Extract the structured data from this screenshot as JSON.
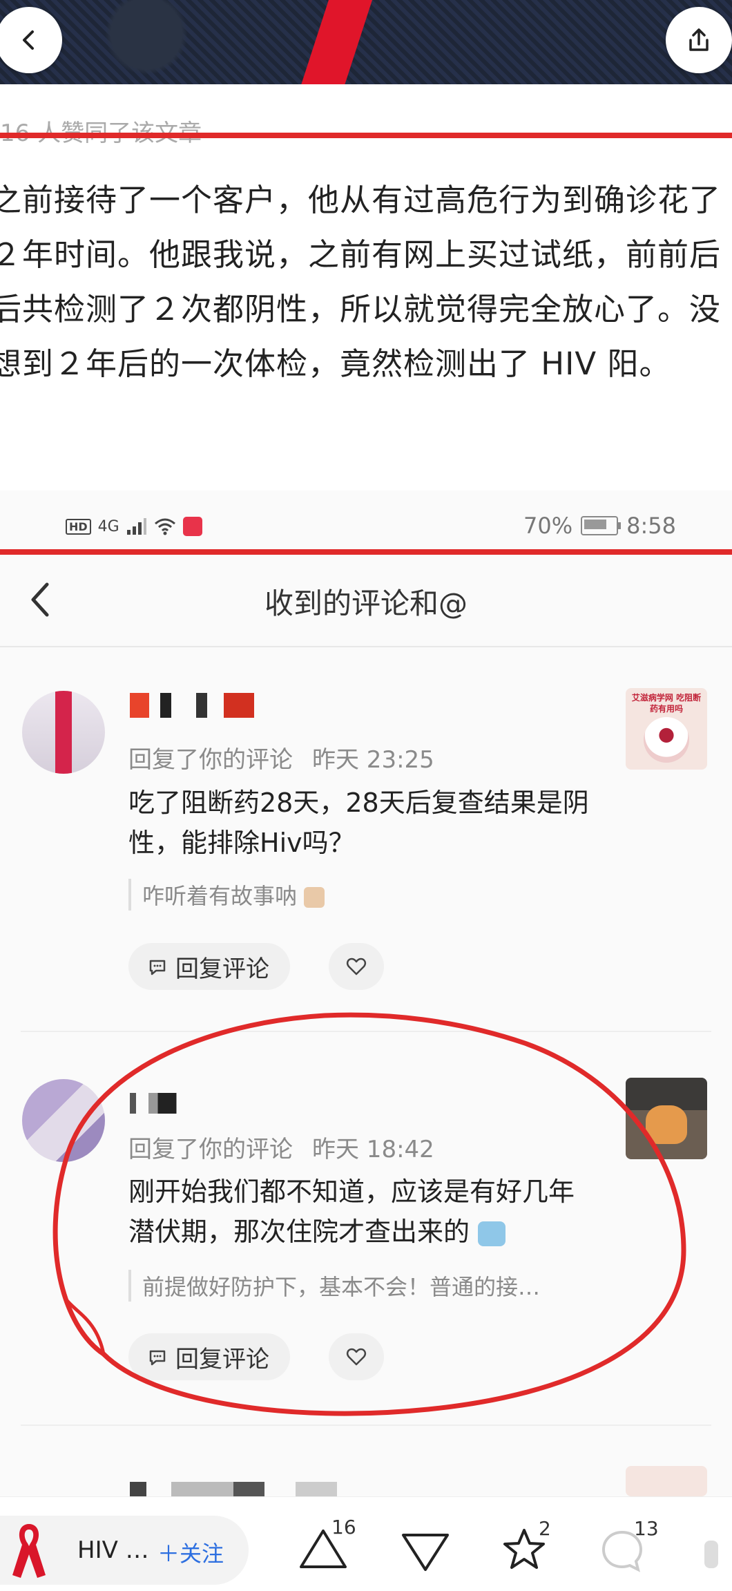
{
  "nav": {
    "likes_text": "16 人赞同了该文章"
  },
  "article": {
    "body": "之前接待了一个客户，他从有过高危行为到确诊花了２年时间。他跟我说，之前有网上买过试纸，前前后后共检测了２次都阴性，所以就觉得完全放心了。没想到２年后的一次体检，竟然检测出了 HIV 阳。"
  },
  "screenshot": {
    "status": {
      "battery": "70%",
      "time": "8:58",
      "network": "4G"
    },
    "title": "收到的评论和@",
    "comments": [
      {
        "action": "回复了你的评论",
        "time": "昨天 23:25",
        "text": "吃了阻断药28天，28天后复查结果是阴性，能排除Hiv吗？",
        "quote": "咋听着有故事呐",
        "reply_label": "回复评论",
        "thumb_caption": "艾滋病学网 吃阻断药有用吗"
      },
      {
        "action": "回复了你的评论",
        "time": "昨天 18:42",
        "text": "刚开始我们都不知道，应该是有好几年潜伏期，那次住院才查出来的",
        "quote": "前提做好防护下，基本不会！普通的接…",
        "reply_label": "回复评论"
      }
    ]
  },
  "bottom": {
    "author": "HIV …",
    "follow": "＋关注",
    "upvotes": "16",
    "stars": "2",
    "comments": "13"
  },
  "colors": {
    "accent_red": "#e02a2a",
    "follow_blue": "#2d6fe0"
  }
}
